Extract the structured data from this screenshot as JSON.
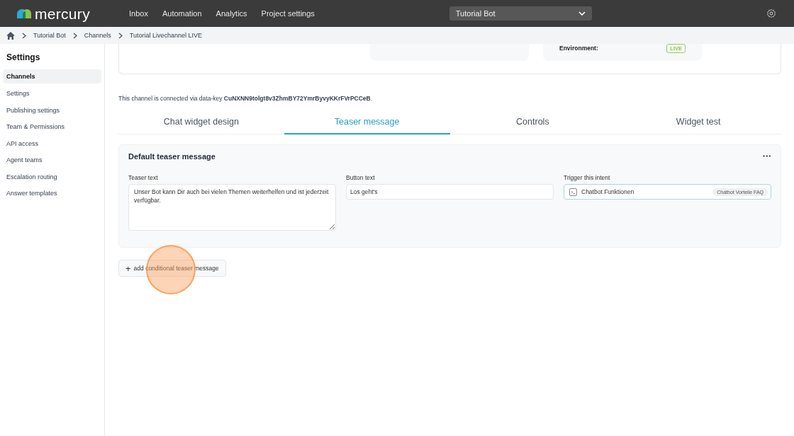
{
  "topbar": {
    "logo": "mercury",
    "nav": [
      {
        "label": "Inbox"
      },
      {
        "label": "Automation"
      },
      {
        "label": "Analytics"
      },
      {
        "label": "Project settings"
      }
    ],
    "project_select": {
      "value": "Tutorial Bot"
    }
  },
  "breadcrumb": [
    "Tutorial Bot",
    "Channels",
    "Tutorial Livechannel LIVE"
  ],
  "sidebar": {
    "title": "Settings",
    "items": [
      {
        "label": "Channels",
        "selected": true
      },
      {
        "label": "Settings",
        "selected": false
      },
      {
        "label": "Publishing settings",
        "selected": false
      },
      {
        "label": "Team & Permissions",
        "selected": false
      },
      {
        "label": "API access",
        "selected": false
      },
      {
        "label": "Agent teams",
        "selected": false
      },
      {
        "label": "Escalation routing",
        "selected": false
      },
      {
        "label": "Answer templates",
        "selected": false
      }
    ]
  },
  "channel_card": {
    "environment_label": "Environment:",
    "environment_badge": "LIVE"
  },
  "data_key_note": "This channel is connected via data-key **CuNXNN9tolgt8v3ZhmBY72YmrByvyKKrFVrPCCeB**.",
  "tabs": [
    {
      "label": "Chat widget design",
      "selected": false
    },
    {
      "label": "Teaser message",
      "selected": true
    },
    {
      "label": "Controls",
      "selected": false
    },
    {
      "label": "Widget test",
      "selected": false
    }
  ],
  "teaser_card": {
    "title": "Default teaser message",
    "more": "•••",
    "teaser_text": {
      "label": "Teaser text",
      "value": "Unser Bot kann Dir auch bei vielen Themen weiterhelfen und ist jederzeit  verfügbar."
    },
    "button_text": {
      "label": "Button text",
      "value": "Los geht's"
    },
    "intent": {
      "label": "Trigger this intent",
      "value": "Chatbot Funktionen",
      "tag": "Chatbot Vorteile FAQ"
    }
  },
  "add_button": {
    "icon": "+",
    "label": "add conditional teaser message"
  }
}
